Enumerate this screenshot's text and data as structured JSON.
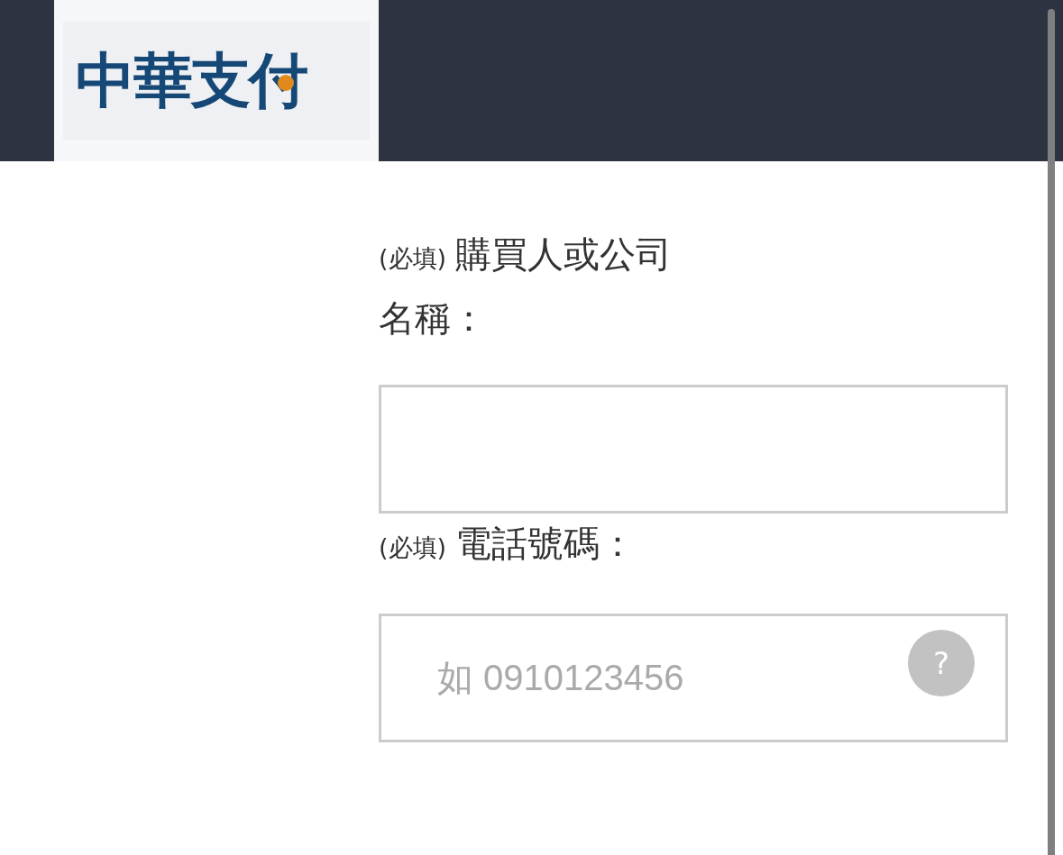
{
  "header": {
    "logo": {
      "text": "中華支付"
    }
  },
  "fields": [
    {
      "required_tag": "(必填)",
      "label": "購買人或公司名稱："
    },
    {
      "required_tag": "(必填)",
      "label": "電話號碼：",
      "placeholder": "如 0910123456",
      "help": "?"
    }
  ]
}
